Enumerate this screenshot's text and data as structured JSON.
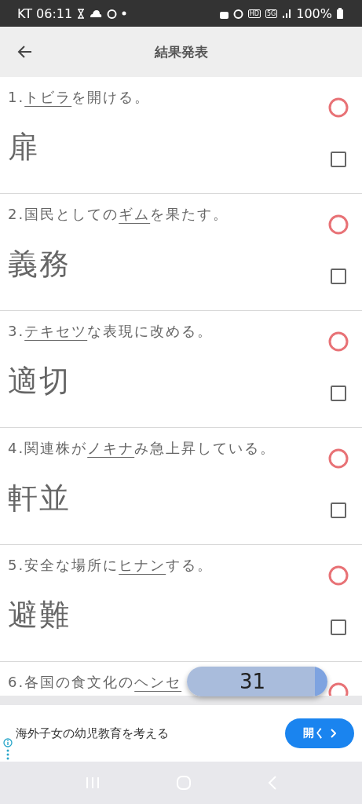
{
  "status_bar": {
    "carrier_time": "KT 06:11",
    "hd": "HD",
    "network": "5G",
    "battery": "100%"
  },
  "header": {
    "title": "結果発表"
  },
  "items": [
    {
      "number": "1.",
      "underlined": "トビラ",
      "after": "を開ける。",
      "answer": "扉",
      "correct": true,
      "checked": false
    },
    {
      "number": "2.",
      "before": "国民としての",
      "underlined": "ギム",
      "after": "を果たす。",
      "answer": "義務",
      "correct": true,
      "checked": false
    },
    {
      "number": "3.",
      "underlined": "テキセツ",
      "after": "な表現に改める。",
      "answer": "適切",
      "correct": true,
      "checked": false
    },
    {
      "number": "4.",
      "before": "関連株が",
      "underlined": "ノキナ",
      "after": "み急上昇している。",
      "answer": "軒並",
      "correct": true,
      "checked": false
    },
    {
      "number": "5.",
      "before": "安全な場所に",
      "underlined": "ヒナン",
      "after": "する。",
      "answer": "避難",
      "correct": true,
      "checked": false
    },
    {
      "number": "6.",
      "before": "各国の食文化の",
      "underlined": "ヘンセ",
      "correct": true
    }
  ],
  "counter": {
    "value": "31"
  },
  "ad": {
    "text": "海外子女の幼児教育を考える",
    "button": "開く"
  }
}
